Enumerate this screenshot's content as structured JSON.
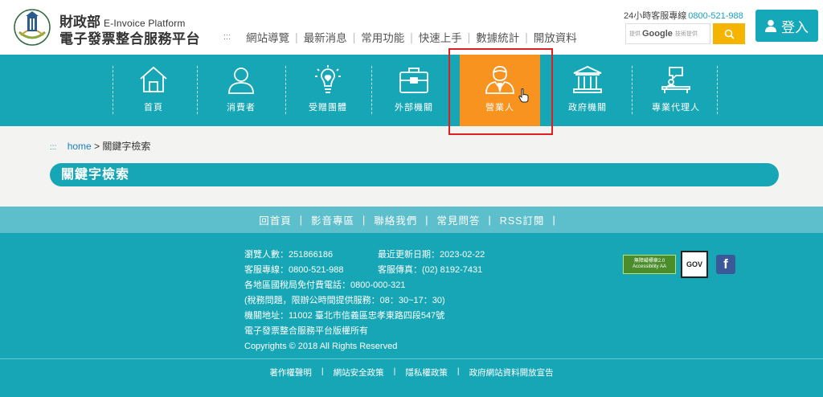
{
  "header": {
    "brand_ministry": "財政部",
    "brand_en": "E-Invoice Platform",
    "brand_zh": "電子發票整合服務平台",
    "topnav_dots": ":::",
    "topnav": [
      "網站導覽",
      "最新消息",
      "常用功能",
      "快速上手",
      "數據統計",
      "開放資料"
    ],
    "hotline_label": "24小時客服專線",
    "hotline_number": "0800-521-988",
    "search_brand": "Google",
    "search_placeholder": "技術提供",
    "search_prefix": "提供",
    "login_label": "登入"
  },
  "mainnav": {
    "items": [
      {
        "label": "首頁",
        "icon": "house-icon"
      },
      {
        "label": "消費者",
        "icon": "person-icon"
      },
      {
        "label": "受贈團體",
        "icon": "lightbulb-heart-icon"
      },
      {
        "label": "外部機關",
        "icon": "briefcase-icon"
      },
      {
        "label": "營業人",
        "icon": "businessman-icon",
        "active": true
      },
      {
        "label": "政府機關",
        "icon": "government-building-icon"
      },
      {
        "label": "專業代理人",
        "icon": "agent-desk-icon"
      }
    ],
    "active_color": "#f7931e",
    "bar_color": "#16a6b6"
  },
  "breadcrumb": {
    "dots": ":::",
    "home": "home",
    "separator": ">",
    "current": "關鍵字檢索"
  },
  "page_title": "關鍵字檢索",
  "footer_nav": [
    "回首頁",
    "影音專區",
    "聯絡我們",
    "常見問答",
    "RSS訂閱"
  ],
  "footer_info": {
    "visitors": "瀏覽人數：251866186",
    "updated": "最近更新日期：2023-02-22",
    "service_line": "客服專線：0800-521-988",
    "fax": "客服傳真：(02) 8192-7431",
    "tax_toll_free": "各地區國稅局免付費電話：0800-000-321",
    "tax_hours": "(稅務問題，限辦公時間提供服務：08：30~17：30)",
    "address": "機關地址：11002 臺北市信義區忠孝東路四段547號",
    "copyright_zh": "電子發票整合服務平台版權所有",
    "copyright_en": "Copyrights © 2018 All Rights Reserved"
  },
  "badges": {
    "accessibility": "無障礙標章2.0 Accessibility AA",
    "gov": "GOV",
    "facebook": "f"
  },
  "footer_links": [
    "著作權聲明",
    "網站安全政策",
    "隱私權政策",
    "政府網站資料開放宣告"
  ]
}
